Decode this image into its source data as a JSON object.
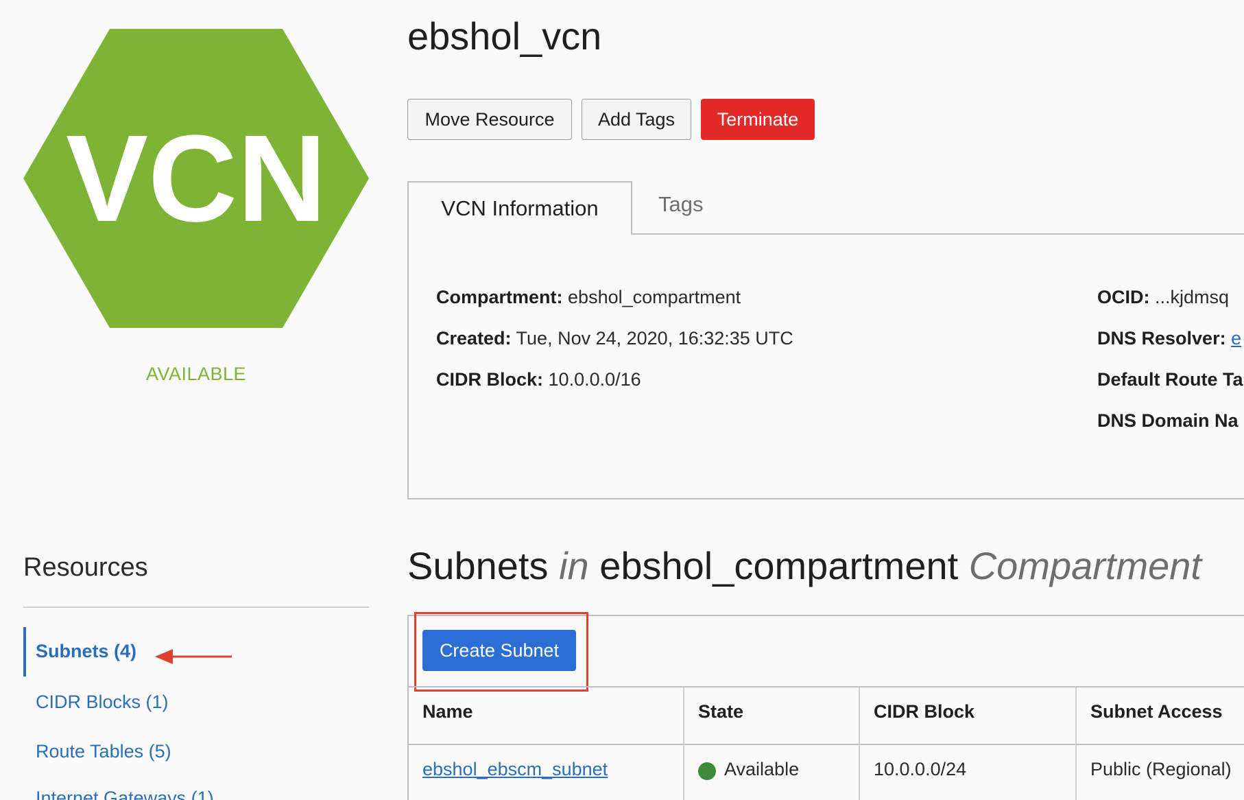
{
  "vcn_logo": {
    "text": "VCN",
    "color": "#7db435"
  },
  "status": "AVAILABLE",
  "title": "ebshol_vcn",
  "actions": {
    "move_resource": "Move Resource",
    "add_tags": "Add Tags",
    "terminate": "Terminate"
  },
  "tabs": {
    "vcn_information": "VCN Information",
    "tags": "Tags"
  },
  "info": {
    "compartment": {
      "label": "Compartment:",
      "value": "ebshol_compartment"
    },
    "created": {
      "label": "Created:",
      "value": "Tue, Nov 24, 2020, 16:32:35 UTC"
    },
    "cidr_block": {
      "label": "CIDR Block:",
      "value": "10.0.0.0/16"
    },
    "ocid": {
      "label": "OCID:",
      "value": "...kjdmsq"
    },
    "dns_resolver": {
      "label": "DNS Resolver:",
      "value": "e"
    },
    "default_route_table": {
      "label": "Default Route Ta"
    },
    "dns_domain_name": {
      "label": "DNS Domain Na"
    }
  },
  "resources": {
    "title": "Resources",
    "items": [
      {
        "label": "Subnets (4)"
      },
      {
        "label": "CIDR Blocks (1)"
      },
      {
        "label": "Route Tables (5)"
      },
      {
        "label": "Internet Gateways (1)"
      }
    ]
  },
  "subnets": {
    "title_main": "Subnets",
    "title_in": "in",
    "title_compartment": "ebshol_compartment",
    "title_suffix": "Compartment",
    "create_button": "Create Subnet",
    "columns": [
      "Name",
      "State",
      "CIDR Block",
      "Subnet Access"
    ],
    "rows": [
      {
        "name": "ebshol_ebscm_subnet",
        "state": "Available",
        "cidr": "10.0.0.0/24",
        "access": "Public (Regional)"
      }
    ]
  },
  "colors": {
    "accent_green": "#7db435",
    "link_blue": "#2a6ebb",
    "primary_blue": "#2a6ed6",
    "danger_red": "#e22b26",
    "status_green": "#3f8a3a",
    "annotation_red": "#e0412e"
  }
}
